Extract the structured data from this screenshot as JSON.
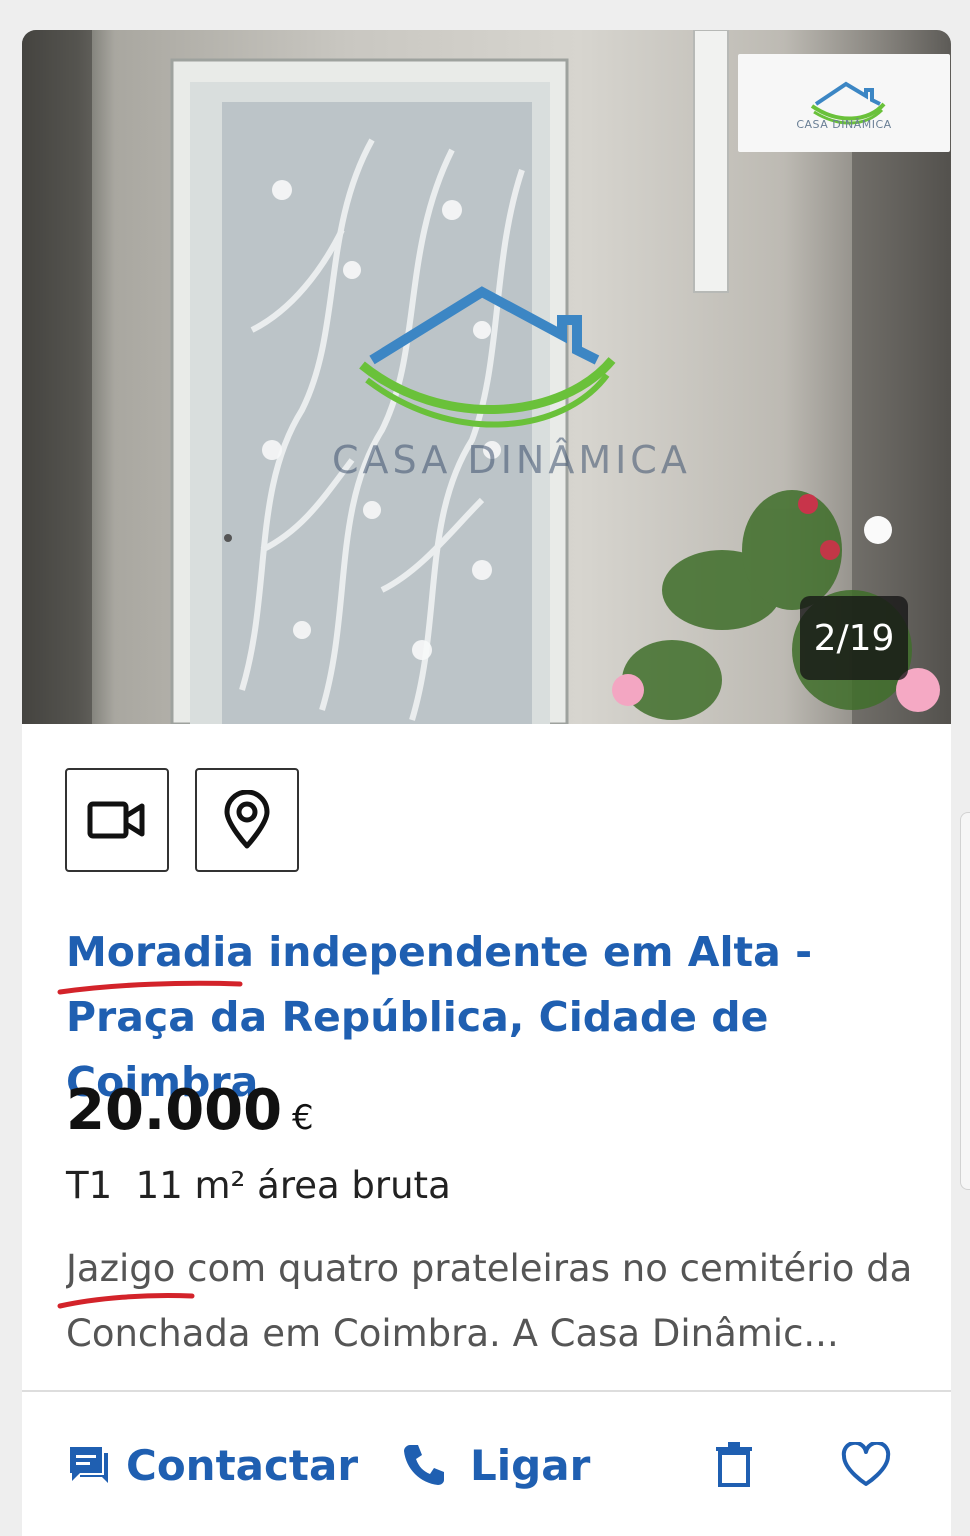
{
  "gallery": {
    "counter": "2/19",
    "watermark": "CASA DINÂMICA",
    "logo_text": "CASA DINÂMICA"
  },
  "toolbar": {
    "video_icon": "video-camera-icon",
    "map_icon": "map-pin-icon"
  },
  "listing": {
    "title": "Moradia independente em Alta - Praça da República, Cidade de Coimbra",
    "price": "20.000",
    "currency": "€",
    "features": "T1  11 m² área bruta",
    "description": "Jazigo com quatro prateleiras no cemitério da Conchada em Coimbra. A Casa Dinâmic..."
  },
  "actions": {
    "contact_label": "Contactar",
    "call_label": "Ligar",
    "delete_icon": "trash-icon",
    "favorite_icon": "heart-icon"
  },
  "colors": {
    "accent": "#1f5fb1",
    "annotation": "#d3232a"
  }
}
